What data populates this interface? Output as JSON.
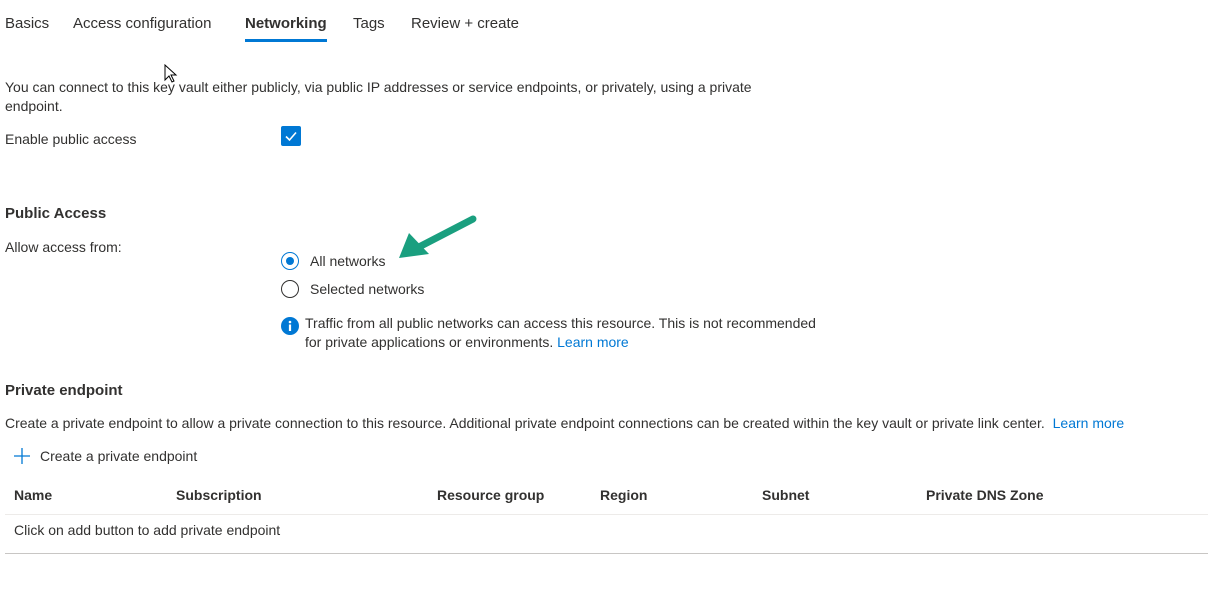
{
  "tabs": [
    {
      "label": "Basics"
    },
    {
      "label": "Access configuration"
    },
    {
      "label": "Networking",
      "active": true
    },
    {
      "label": "Tags"
    },
    {
      "label": "Review + create"
    }
  ],
  "intro_text": "You can connect to this key vault either publicly, via public IP addresses or service endpoints, or privately, using a private endpoint.",
  "public_access_toggle": {
    "label": "Enable public access",
    "checked": true
  },
  "public_access": {
    "title": "Public Access",
    "allow_label": "Allow access from:",
    "options": [
      {
        "label": "All networks",
        "selected": true
      },
      {
        "label": "Selected networks",
        "selected": false
      }
    ],
    "info_text": "Traffic from all public networks can access this resource. This is not recommended for private applications or environments.",
    "learn_more": "Learn more"
  },
  "private_endpoint": {
    "title": "Private endpoint",
    "description": "Create a private endpoint to allow a private connection to this resource. Additional private endpoint connections can be created within the key vault or private link center.",
    "learn_more": "Learn more",
    "create_label": "Create a private endpoint",
    "columns": [
      "Name",
      "Subscription",
      "Resource group",
      "Region",
      "Subnet",
      "Private DNS Zone"
    ],
    "empty_text": "Click on add button to add private endpoint"
  },
  "colors": {
    "accent": "#0078d4",
    "arrow": "#1a9f7f",
    "text": "#323130"
  }
}
